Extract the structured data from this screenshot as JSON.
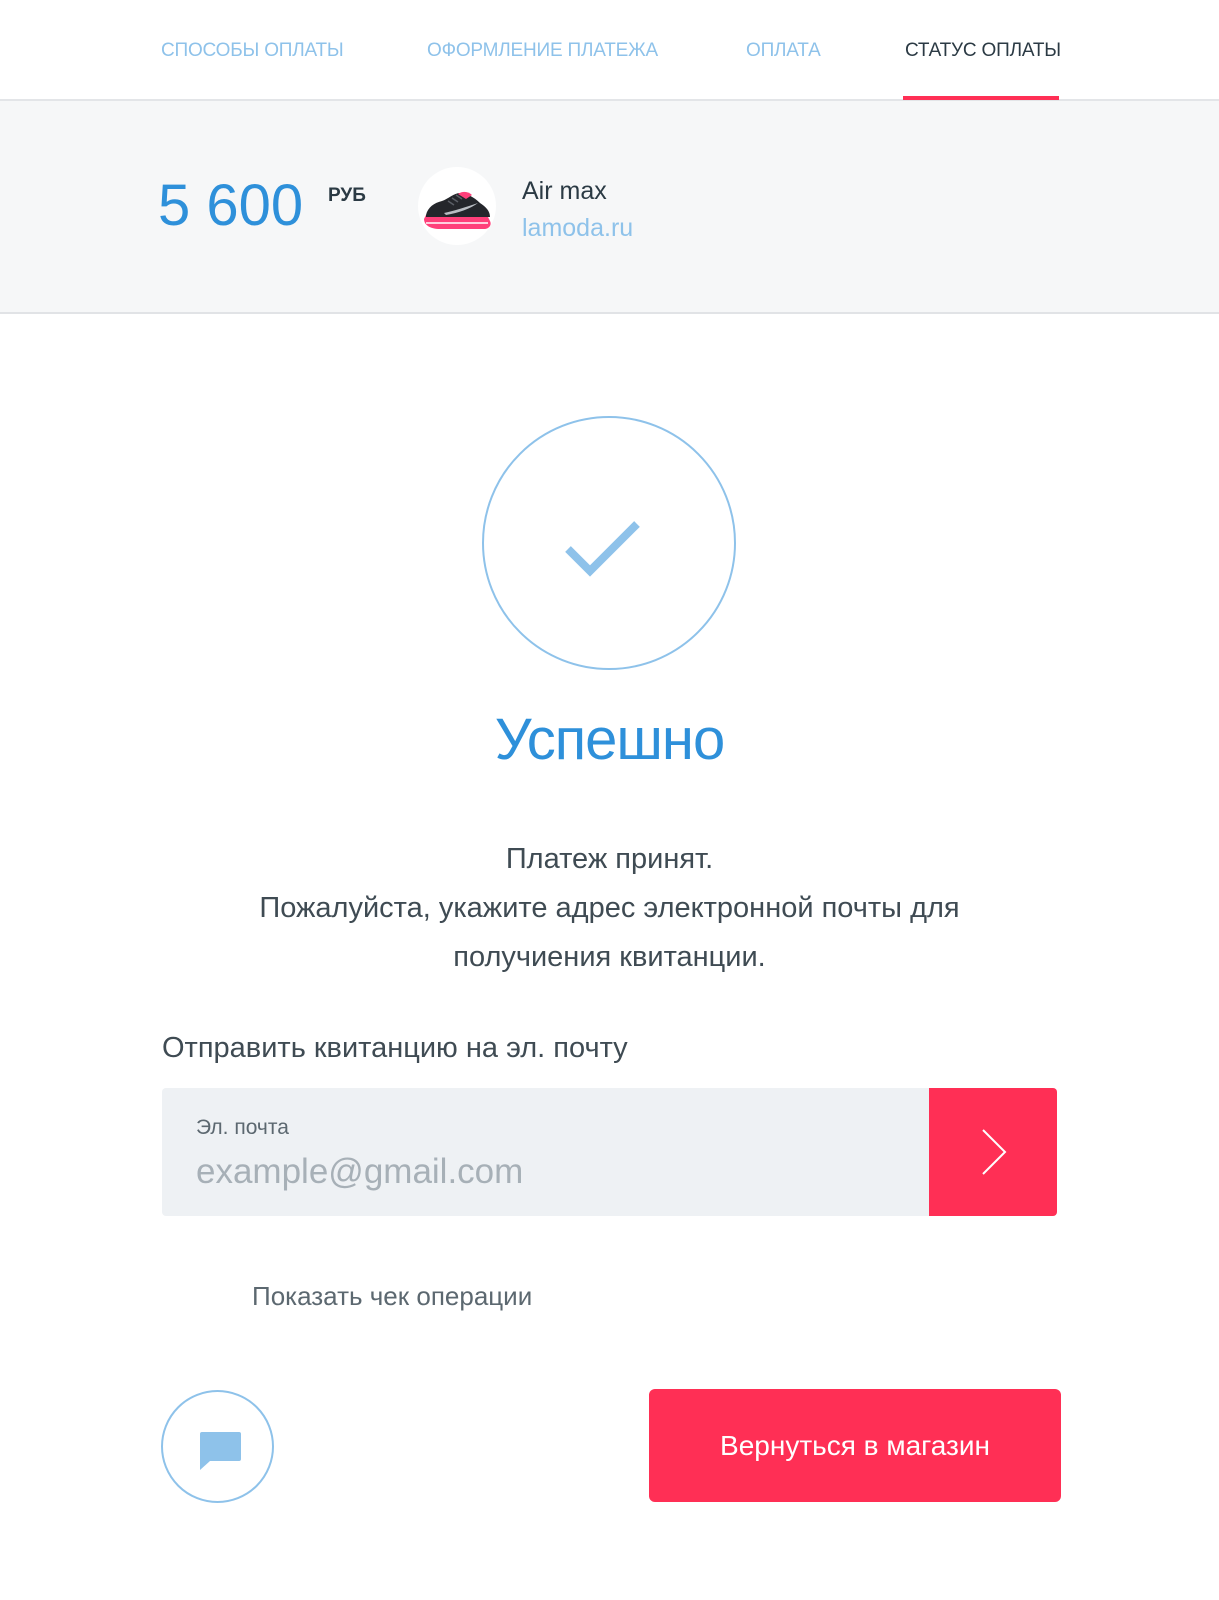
{
  "tabs": [
    {
      "label": "СПОСОБЫ ОПЛАТЫ",
      "active": false
    },
    {
      "label": "ОФОРМЛЕНИЕ ПЛАТЕЖА",
      "active": false
    },
    {
      "label": "ОПЛАТА",
      "active": false
    },
    {
      "label": "СТАТУС ОПЛАТЫ",
      "active": true
    }
  ],
  "order": {
    "amount": "5 600",
    "currency": "РУБ",
    "product_name": "Air max",
    "shop": "lamoda.ru",
    "product_image_icon": "sneaker-icon"
  },
  "status": {
    "icon": "checkmark-icon",
    "title": "Успешно",
    "message_lines": [
      "Платеж принят.",
      "Пожалуйста, укажите адрес электронной почты для",
      "получиения квитанции."
    ]
  },
  "email": {
    "heading": "Отправить квитанцию на эл. почту",
    "label": "Эл. почта",
    "placeholder": "example@gmail.com",
    "value": "",
    "submit_icon": "chevron-right-icon"
  },
  "links": {
    "show_receipt": "Показать чек операции"
  },
  "actions": {
    "chat_icon": "chat-bubble-icon",
    "return_label": "Вернуться в магазин"
  },
  "colors": {
    "accent": "#ff2f55",
    "primary_blue": "#2e90da",
    "light_blue": "#8ec2ea",
    "text_dark": "#2b3a44",
    "summary_bg": "#f6f7f8",
    "input_bg": "#eef1f4"
  }
}
